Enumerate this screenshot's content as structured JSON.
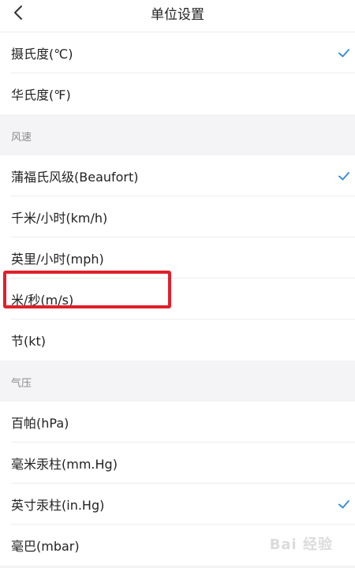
{
  "header": {
    "title": "单位设置",
    "back_icon": "chevron-left-icon"
  },
  "temperature": {
    "items": [
      {
        "label": "摄氏度(℃)",
        "selected": true
      },
      {
        "label": "华氏度(℉)",
        "selected": false
      }
    ]
  },
  "wind": {
    "section_title": "风速",
    "items": [
      {
        "label": "蒲福氏风级(Beaufort)",
        "selected": true
      },
      {
        "label": "千米/小时(km/h)",
        "selected": false
      },
      {
        "label": "英里/小时(mph)",
        "selected": false
      },
      {
        "label": "米/秒(m/s)",
        "selected": false
      },
      {
        "label": "节(kt)",
        "selected": false
      }
    ]
  },
  "pressure": {
    "section_title": "气压",
    "items": [
      {
        "label": "百帕(hPa)",
        "selected": false
      },
      {
        "label": "毫米汞柱(mm.Hg)",
        "selected": false
      },
      {
        "label": "英寸汞柱(in.Hg)",
        "selected": true
      },
      {
        "label": "毫巴(mbar)",
        "selected": false
      }
    ]
  },
  "annotation": {
    "highlight_color": "#e0202a",
    "highlighted_item": "米/秒(m/s)"
  },
  "watermark": {
    "text": "Bai 经验"
  },
  "colors": {
    "check": "#3b8fd6"
  }
}
